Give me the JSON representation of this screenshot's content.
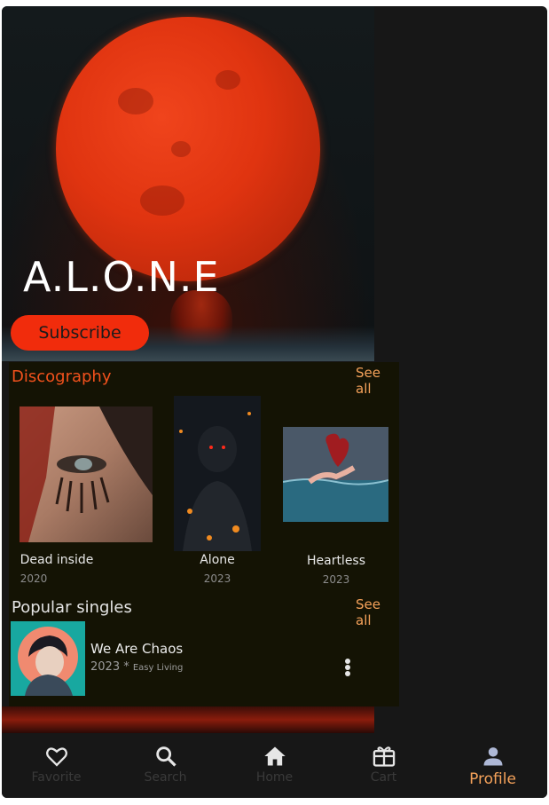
{
  "artist": {
    "name": "A.L.O.N.E",
    "subscribe_label": "Subscribe"
  },
  "discography": {
    "title": "Discography",
    "see_all": "See all",
    "albums": [
      {
        "title": "Dead inside",
        "year": "2020"
      },
      {
        "title": "Alone",
        "year": "2023"
      },
      {
        "title": "Heartless",
        "year": "2023"
      }
    ]
  },
  "popular_singles": {
    "title": "Popular singles",
    "see_all": "See all",
    "items": [
      {
        "title": "We Are Chaos",
        "year": "2023",
        "label": "Easy Living"
      }
    ]
  },
  "nav": {
    "items": [
      {
        "label": "Favorite",
        "icon": "heart-icon"
      },
      {
        "label": "Search",
        "icon": "search-icon"
      },
      {
        "label": "Home",
        "icon": "home-icon"
      },
      {
        "label": "Cart",
        "icon": "cart-icon"
      },
      {
        "label": "Profile",
        "icon": "person-icon",
        "active": true
      }
    ]
  },
  "colors": {
    "accent": "#f5a25a",
    "discography_title": "#f2511c",
    "subscribe_button": "#f12c0c",
    "nav_inactive_icon": "#e6e6e6"
  }
}
